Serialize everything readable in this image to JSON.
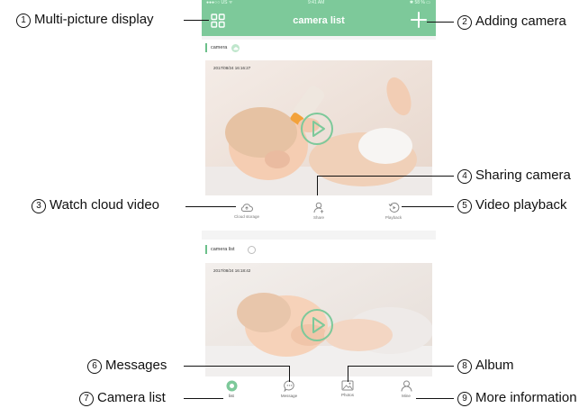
{
  "status_bar": {
    "carrier": "●●●○○ US ᯤ",
    "time": "9:41 AM",
    "battery": "✱ 58 % ▭"
  },
  "header": {
    "title": "camera list"
  },
  "cards": [
    {
      "name": "camera",
      "timestamp": "2017/08/24 16:16:27"
    },
    {
      "name": "camera list",
      "timestamp": "2017/08/24 16:18:42"
    }
  ],
  "actions": {
    "cloud": "Cloud storage",
    "share": "Share",
    "playback": "Playback"
  },
  "tabs": [
    {
      "label": "list"
    },
    {
      "label": "Message"
    },
    {
      "label": "Photos"
    },
    {
      "label": "Mine"
    }
  ],
  "annotations": [
    {
      "num": "1",
      "text": "Multi-picture display"
    },
    {
      "num": "2",
      "text": "Adding camera"
    },
    {
      "num": "3",
      "text": "Watch cloud video"
    },
    {
      "num": "4",
      "text": "Sharing camera"
    },
    {
      "num": "5",
      "text": "Video playback"
    },
    {
      "num": "6",
      "text": "Messages"
    },
    {
      "num": "7",
      "text": "Camera list"
    },
    {
      "num": "8",
      "text": "Album"
    },
    {
      "num": "9",
      "text": "More information"
    }
  ],
  "colors": {
    "accent": "#7dc99a",
    "accent_dark": "#6cc08a",
    "annotation": "#111111"
  },
  "icons": [
    "grid-icon",
    "plus-icon",
    "cloud-upload-icon",
    "person-icon",
    "replay-icon",
    "play-icon",
    "camera-tab-icon",
    "message-icon",
    "photo-icon",
    "user-icon"
  ]
}
